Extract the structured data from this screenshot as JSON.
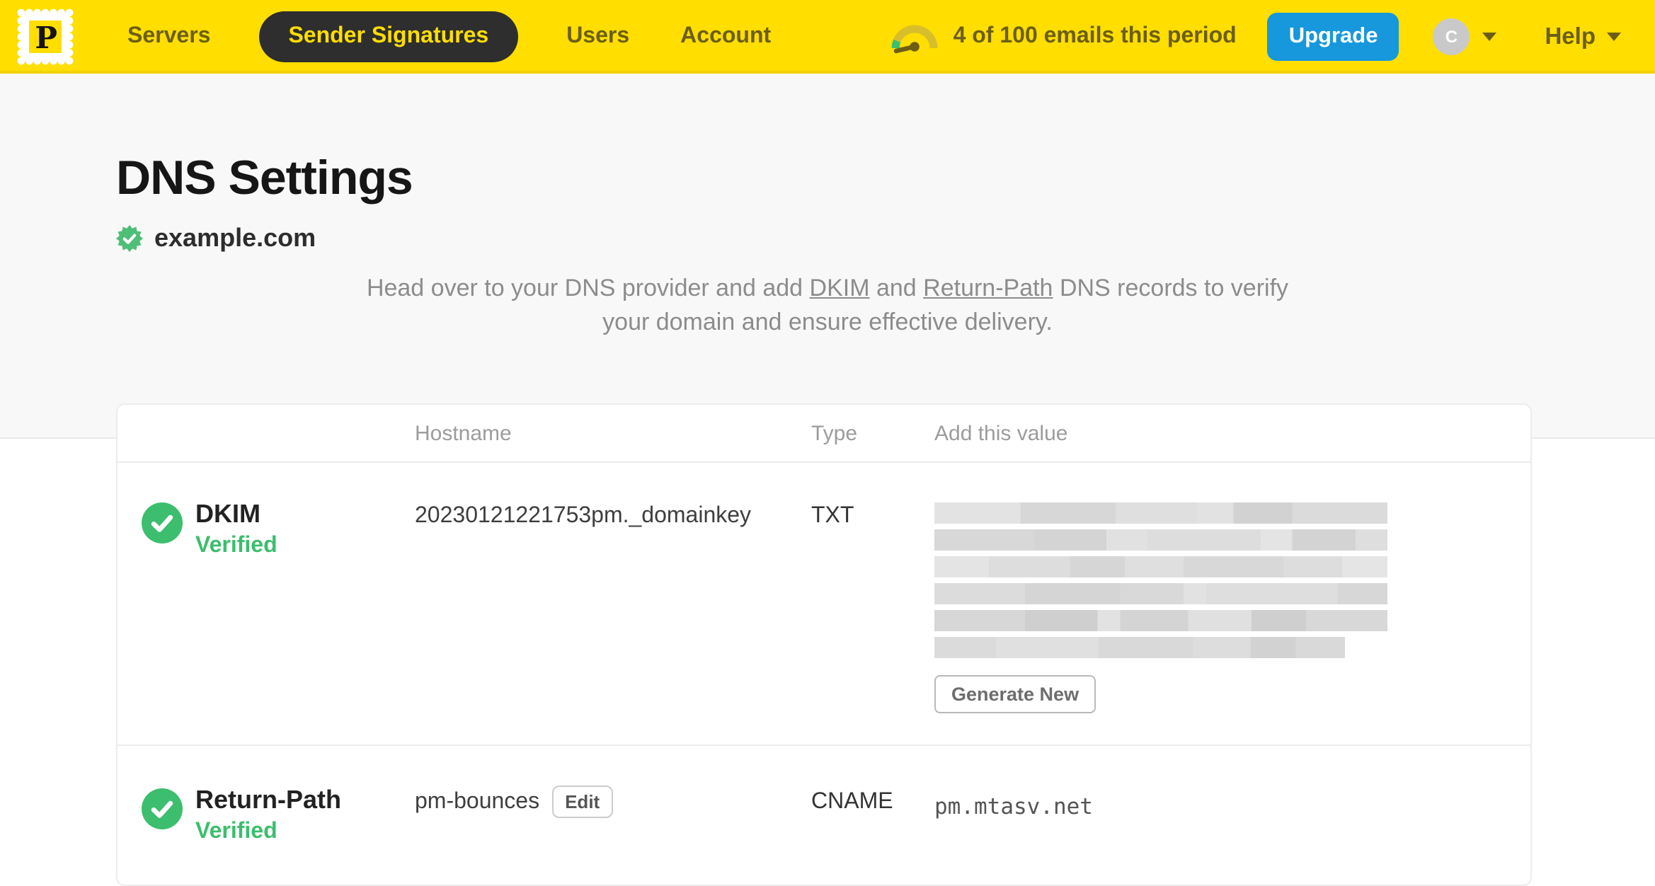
{
  "colors": {
    "brand_yellow": "#FFDE00",
    "nav_text_olive": "#6C5E15",
    "active_pill_bg": "#2E2E2E",
    "upgrade_blue": "#1797DC",
    "verified_green": "#3CBE6E"
  },
  "navbar": {
    "logo_letter": "P",
    "items": [
      {
        "label": "Servers",
        "active": false
      },
      {
        "label": "Sender Signatures",
        "active": true
      },
      {
        "label": "Users",
        "active": false
      },
      {
        "label": "Account",
        "active": false
      }
    ],
    "usage_text": "4 of 100 emails this period",
    "upgrade_label": "Upgrade",
    "avatar_initial": "C",
    "help_label": "Help"
  },
  "page": {
    "title": "DNS Settings",
    "domain": "example.com",
    "description": {
      "part1": "Head over to your DNS provider and add ",
      "link1": "DKIM",
      "part2": " and ",
      "link2": "Return-Path",
      "part3": " DNS records to verify your domain and ensure effective delivery."
    }
  },
  "table": {
    "headers": {
      "hostname": "Hostname",
      "type": "Type",
      "value": "Add this value"
    },
    "rows": [
      {
        "name": "DKIM",
        "status": "Verified",
        "hostname": "20230121221753pm._domainkey",
        "type": "TXT",
        "value_redacted": true,
        "action_label": "Generate New"
      },
      {
        "name": "Return-Path",
        "status": "Verified",
        "hostname": "pm-bounces",
        "edit_label": "Edit",
        "type": "CNAME",
        "value": "pm.mtasv.net"
      }
    ]
  }
}
